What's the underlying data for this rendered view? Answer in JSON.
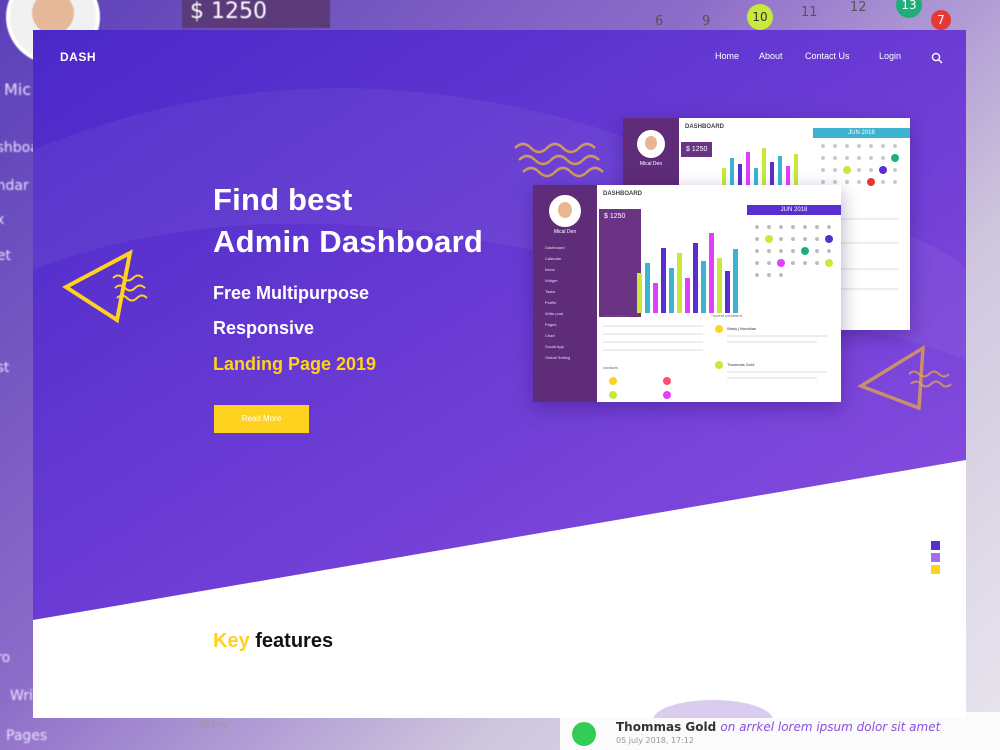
{
  "backdrop": {
    "price": "$ 1250",
    "calendar_numbers": [
      "6",
      "9",
      "10",
      "11",
      "12",
      "13",
      "7"
    ],
    "side_labels": [
      "Mic",
      "ashboard",
      "endar",
      "ox",
      "get",
      "ost",
      "Pro",
      "Writ",
      "Pages"
    ],
    "bottom_author": "Thommas Gold",
    "bottom_text": "on arrkel lorem ipsum dolor sit amet",
    "bottom_date": "05 july 2018, 17:12",
    "bottom_small": "90 July"
  },
  "header": {
    "logo": "DASH",
    "nav": [
      "Home",
      "About",
      "Contact Us",
      "Login"
    ],
    "search_icon": "search-icon"
  },
  "hero": {
    "title_line1": "Find best",
    "title_line2": "Admin Dashboard",
    "subtitle1": "Free Multipurpose",
    "subtitle2": "Responsive",
    "subtitle3": "Landing Page 2019",
    "cta": "Read More"
  },
  "features": {
    "heading_highlight": "Key",
    "heading_rest": "features"
  },
  "mockup": {
    "back_title": "DASHBOARD",
    "back_price": "$ 1250",
    "back_month": "JUN   2018",
    "front_title": "DASHBOARD",
    "front_price": "$ 1250",
    "front_month": "JUN   2018",
    "user_name": "Mical Den",
    "menu": [
      "Dashboard",
      "Calendar",
      "Inbox",
      "Widget",
      "Tasks",
      "Profile",
      "Write post",
      "Pages",
      "Chart",
      "Social App",
      "Global Setting"
    ],
    "panels": [
      "recent orders",
      "contacts",
      "recent comment"
    ],
    "comment_author_1": "Warly j Numbian",
    "comment_author_2": "Thommas Gold"
  },
  "colors": {
    "purple_dark": "#4a28c8",
    "purple_light": "#8b4fe0",
    "yellow": "#ffd21f",
    "ink": "#111111"
  }
}
